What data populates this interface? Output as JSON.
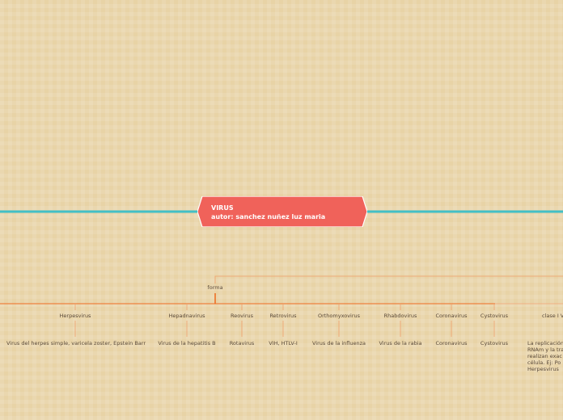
{
  "central": {
    "title": "VIRUS",
    "author": "autor: sanchez nuñez luz maria",
    "fill": "#f0625a"
  },
  "connector": {
    "label": "forma"
  },
  "colors": {
    "spine": "#43bfc6",
    "branch": "#f0a06c",
    "branch_strong": "#ee6a1e"
  },
  "branches": [
    {
      "name": "Herpesvirus",
      "example": "Virus del herpes simple, varicela zoster, Epstein Barr"
    },
    {
      "name": "Hepadnavirus",
      "example": "Virus de la hepatitis B"
    },
    {
      "name": "Reovirus",
      "example": "Rotavirus"
    },
    {
      "name": "Retrovirus",
      "example": "VIH, HTLV-I"
    },
    {
      "name": "Orthomyxovirus",
      "example": "Virus de la influenza"
    },
    {
      "name": "Rhabdovirus",
      "example": "Virus de la rabia"
    },
    {
      "name": "Coronavirus",
      "example": "Coronavirus"
    },
    {
      "name": "Cystovirus",
      "example": "Cystovirus"
    }
  ],
  "clase": {
    "name": "clase I V",
    "note_lines": [
      "La replicación",
      "RNAm y la tra",
      "realizan exac",
      "célula. Ej: Po",
      "Herpesvirus"
    ]
  }
}
